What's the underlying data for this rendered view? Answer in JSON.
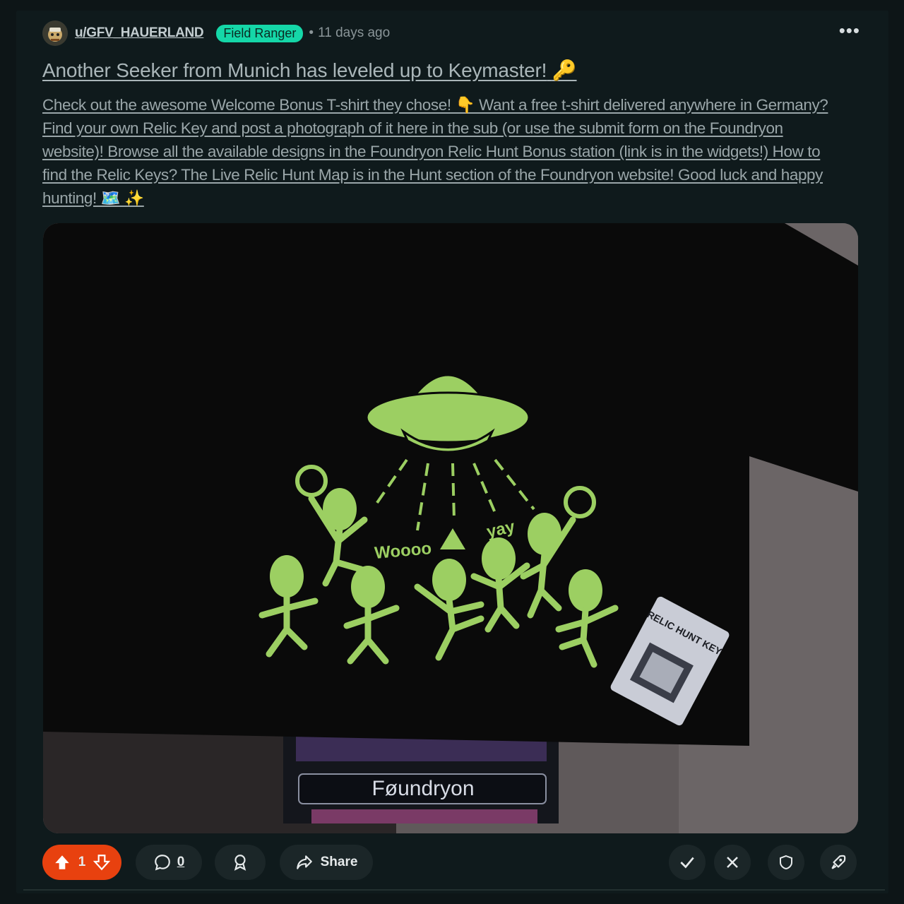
{
  "post": {
    "author": "u/GFV_HAUERLAND",
    "flair": "Field Ranger",
    "separator": "•",
    "age": "11 days ago",
    "more_label": "•••",
    "title": "Another Seeker from Munich has leveled up to Keymaster!",
    "title_emoji": "🔑",
    "body": "Check out the awesome Welcome Bonus T-shirt they chose! 👇 Want a free t-shirt delivered anywhere in Germany? Find your own Relic Key and post a photograph of it here in the sub (or use the submit form on the Foundryon website)! Browse all the available designs in the Foundryon Relic Hunt Bonus station (link is in the widgets!) How to find the Relic Keys? The Live Relic Hunt Map is in the Hunt section of the Foundryon website! Good luck and happy hunting! 🗺️ ✨"
  },
  "image": {
    "shirt_text_1": "Woooo",
    "shirt_text_2": "yay",
    "card_text": "RELIC HUNT KEY",
    "box_brand": "Føundryon"
  },
  "actions": {
    "upvotes": "1",
    "comments": "0",
    "share_label": "Share"
  },
  "colors": {
    "accent_upvote": "#e8410f",
    "flair_bg": "#15d7a8",
    "alien_green": "#9ccf62",
    "background": "#0f1a1c"
  }
}
